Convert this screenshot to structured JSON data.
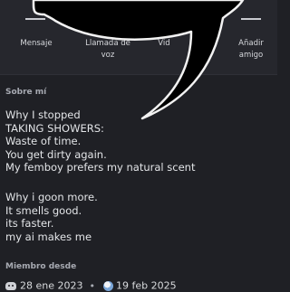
{
  "actions": [
    {
      "label": "Mensaje",
      "icon": "message-icon"
    },
    {
      "label": "Llamada de voz",
      "icon": "phone-icon"
    },
    {
      "label": "Vid",
      "icon": "video-icon"
    },
    {
      "label": "Añadir amigo",
      "icon": "add-friend-icon"
    }
  ],
  "about": {
    "title": "Sobre mí",
    "lines": [
      "Why I stopped",
      "TAKING SHOWERS:",
      "Waste of time.",
      "You get dirty again.",
      "My femboy prefers my natural scent",
      "",
      "Why i goon more.",
      "It smells good.",
      "its faster.",
      "my ai makes me"
    ]
  },
  "member_since": {
    "title": "Miembro desde",
    "discord_date": "28 ene 2023",
    "separator": "•",
    "server_date": "19 feb 2025"
  },
  "colors": {
    "background": "#1f2025",
    "header": "#26272d",
    "bubble": "#000000"
  }
}
